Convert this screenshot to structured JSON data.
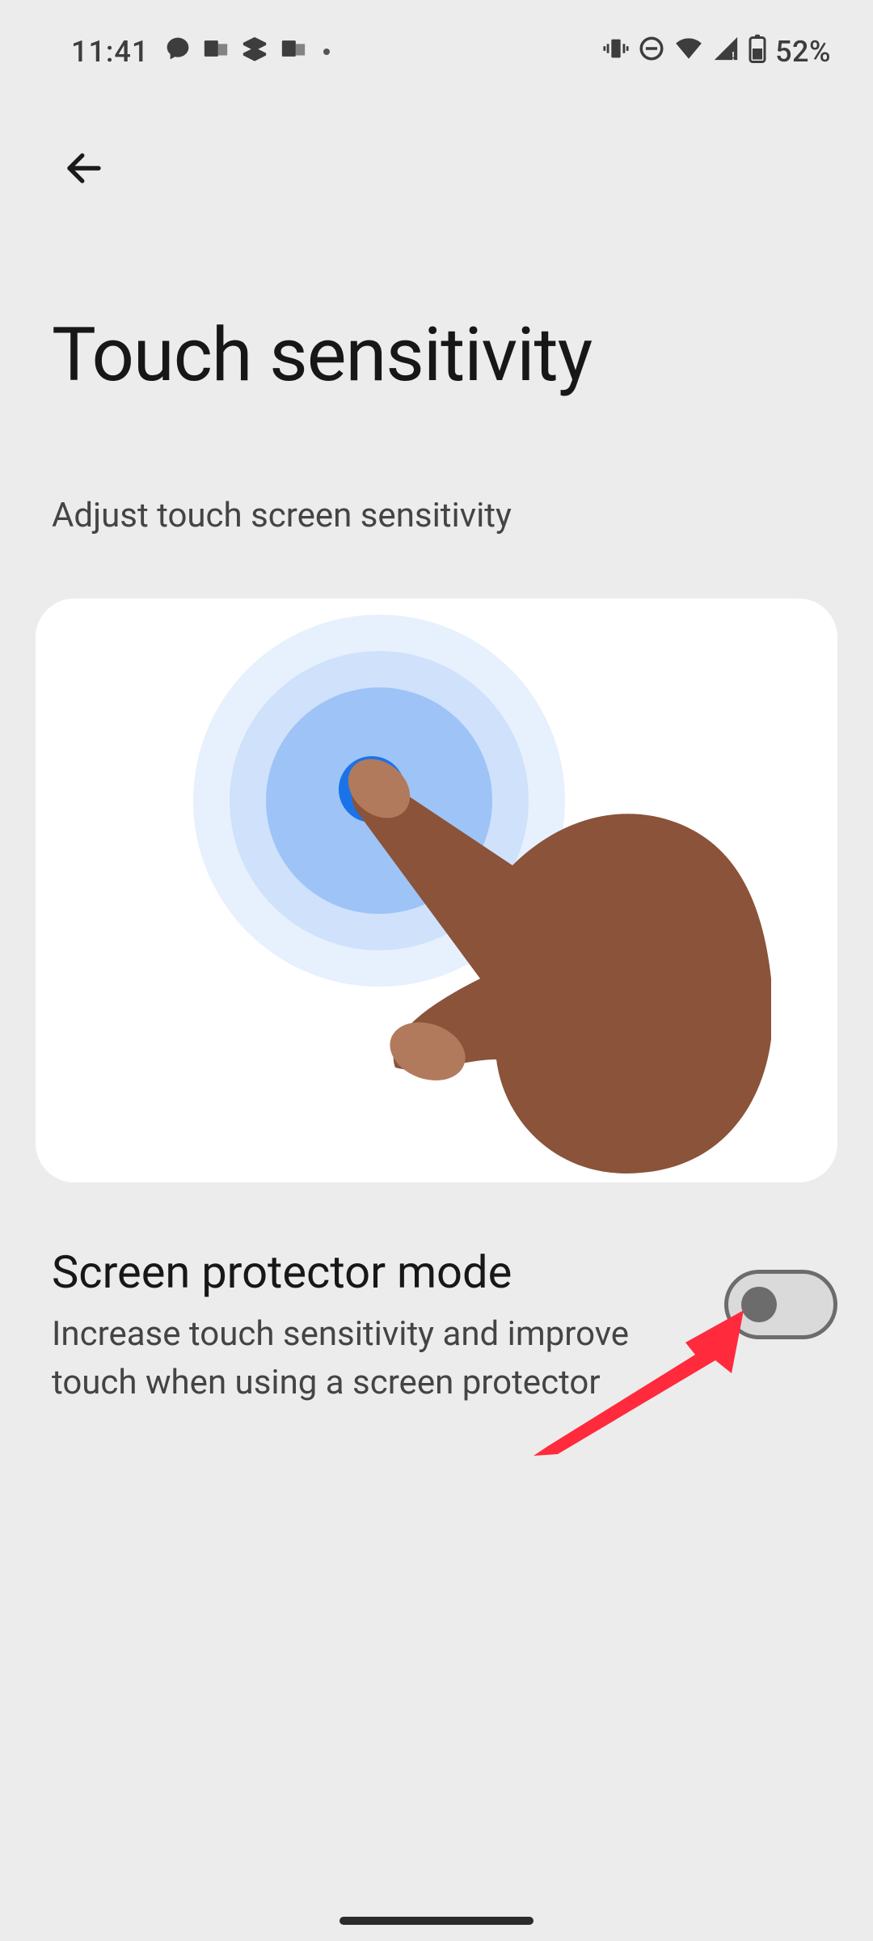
{
  "status": {
    "time": "11:41",
    "battery": "52%"
  },
  "page": {
    "title": "Touch sensitivity",
    "subtitle": "Adjust touch screen sensitivity"
  },
  "setting": {
    "title": "Screen protector mode",
    "description": "Increase touch sensitivity and improve touch when using a screen protector",
    "enabled": false
  }
}
